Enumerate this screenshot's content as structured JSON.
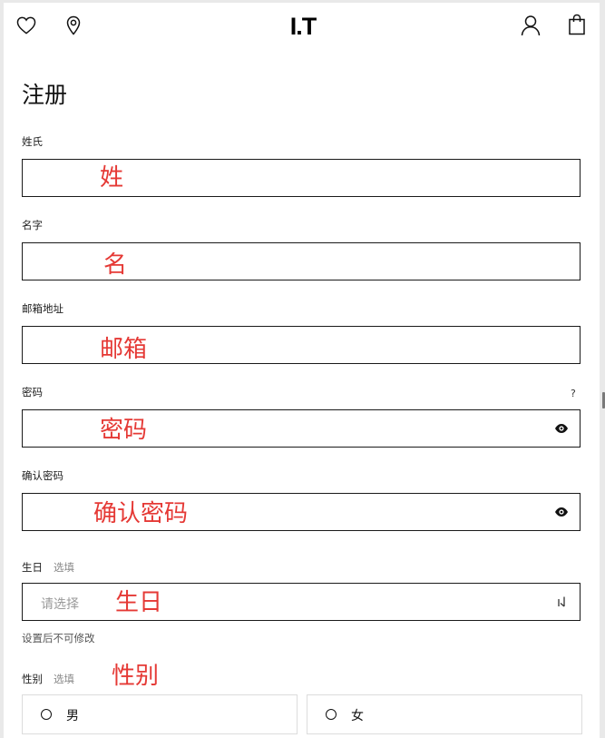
{
  "header": {
    "logo": "I.T",
    "icons": [
      "heart-icon",
      "location-pin-icon",
      "user-icon",
      "shopping-bag-icon"
    ]
  },
  "page": {
    "title": "注册"
  },
  "form": {
    "last_name": {
      "label": "姓氏",
      "annotation": "姓"
    },
    "first_name": {
      "label": "名字",
      "annotation": "名"
    },
    "email": {
      "label": "邮箱地址",
      "annotation": "邮箱"
    },
    "password": {
      "label": "密码",
      "help": "?",
      "annotation": "密码",
      "icon": "eye-icon"
    },
    "confirm_password": {
      "label": "确认密码",
      "annotation": "确认密码",
      "icon": "eye-icon"
    },
    "birthday": {
      "label": "生日",
      "optional": "选填",
      "placeholder": "请选择",
      "annotation": "生日",
      "hint": "设置后不可修改",
      "icon": "dropdown-arrow-icon"
    },
    "gender": {
      "label": "性别",
      "optional": "选填",
      "annotation": "性别",
      "options": [
        "男",
        "女"
      ]
    }
  },
  "colors": {
    "annotation": "#e53935",
    "border": "#1a1a1a",
    "muted": "#888888"
  }
}
